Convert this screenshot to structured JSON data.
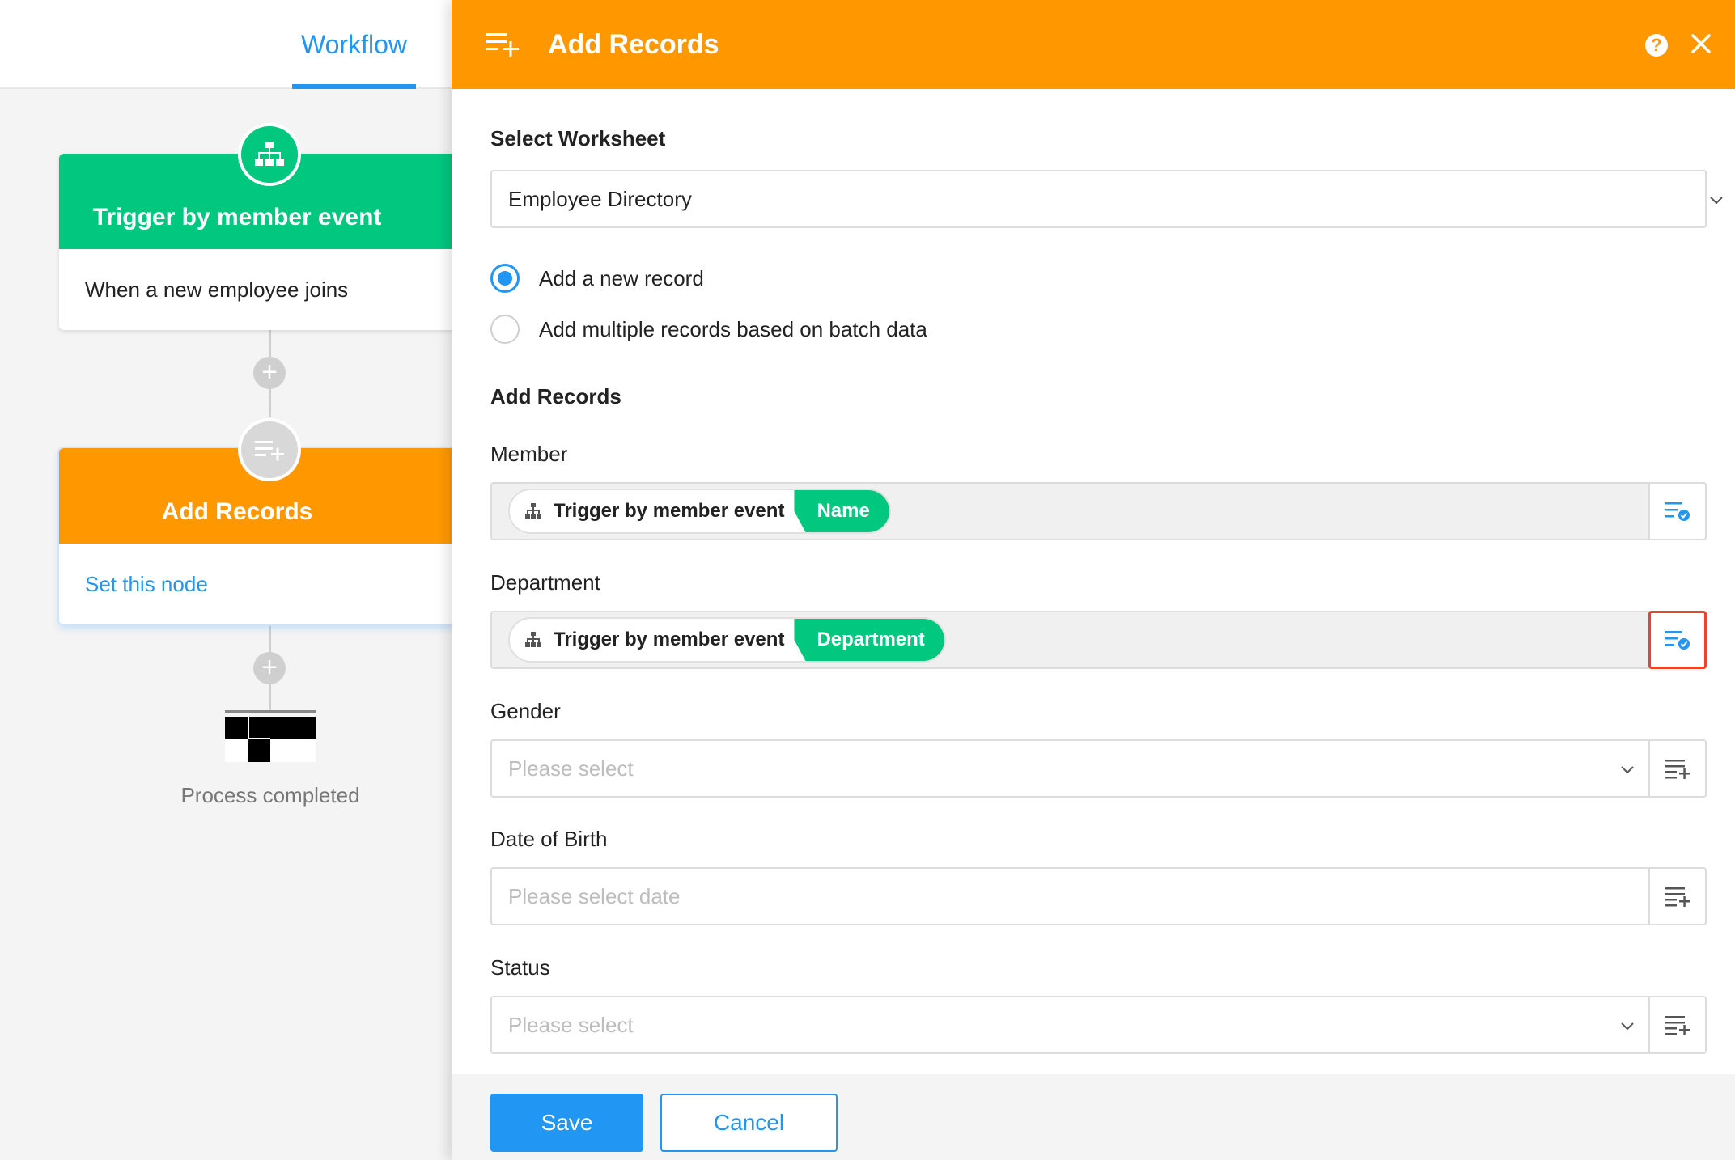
{
  "workflow": {
    "tab_label": "Workflow",
    "trigger_node": {
      "title": "Trigger by member event",
      "description": "When a new employee joins"
    },
    "action_node": {
      "title": "Add Records",
      "link": "Set this node"
    },
    "end_label": "Process completed"
  },
  "panel": {
    "title": "Add Records",
    "help_symbol": "?",
    "select_worksheet_label": "Select Worksheet",
    "worksheet_value": "Employee Directory",
    "radio_options": [
      {
        "label": "Add a new record",
        "selected": true
      },
      {
        "label": "Add multiple records based on batch data",
        "selected": false
      }
    ],
    "add_records_label": "Add Records",
    "fields": {
      "member": {
        "label": "Member",
        "source": "Trigger by member event",
        "value": "Name"
      },
      "department": {
        "label": "Department",
        "source": "Trigger by member event",
        "value": "Department"
      },
      "gender": {
        "label": "Gender",
        "placeholder": "Please select"
      },
      "dob": {
        "label": "Date of Birth",
        "placeholder": "Please select date"
      },
      "status": {
        "label": "Status",
        "placeholder": "Please select"
      }
    },
    "save_label": "Save",
    "cancel_label": "Cancel"
  },
  "colors": {
    "accent": "#2196f3",
    "trigger_green": "#01c77f",
    "action_orange": "#ff9800",
    "highlight_red": "#e8452c"
  },
  "icons": [
    "org-chart-icon",
    "list-add-icon",
    "help-icon",
    "close-icon",
    "chevron-down-icon",
    "clear-icon",
    "field-select-icon",
    "finish-flag-icon"
  ]
}
